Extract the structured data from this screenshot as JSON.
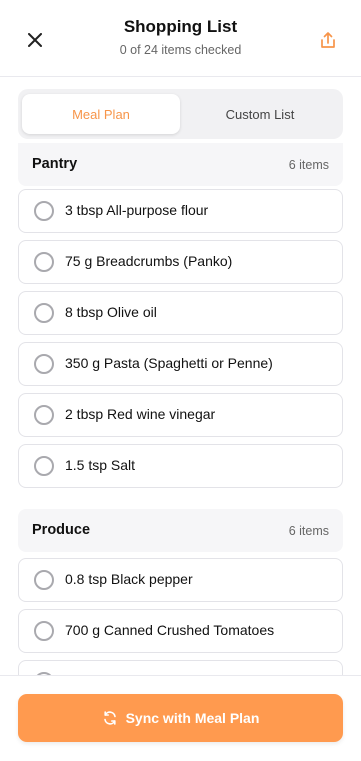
{
  "header": {
    "title": "Shopping List",
    "subtitle": "0 of 24 items checked"
  },
  "tabs": [
    {
      "label": "Meal Plan",
      "active": true
    },
    {
      "label": "Custom List",
      "active": false
    }
  ],
  "sections": {
    "pantry": {
      "title": "Pantry",
      "count": "6 items",
      "items": [
        {
          "label": "3 tbsp All-purpose flour",
          "checked": false
        },
        {
          "label": "75 g Breadcrumbs (Panko)",
          "checked": false
        },
        {
          "label": "8 tbsp Olive oil",
          "checked": false
        },
        {
          "label": "350 g Pasta (Spaghetti or Penne)",
          "checked": false
        },
        {
          "label": "2 tbsp Red wine vinegar",
          "checked": false
        },
        {
          "label": "1.5 tsp Salt",
          "checked": false
        }
      ]
    },
    "produce": {
      "title": "Produce",
      "count": "6 items",
      "items": [
        {
          "label": "0.8 tsp Black pepper",
          "checked": false
        },
        {
          "label": "700 g Canned Crushed Tomatoes",
          "checked": false
        }
      ]
    }
  },
  "footer": {
    "sync_label": "Sync with Meal Plan"
  },
  "colors": {
    "accent": "#ff9a4f",
    "accent_text": "#f7954a",
    "border": "#e3e3e8",
    "section_bg": "#f6f6f8"
  },
  "icons": {
    "close": "close-icon",
    "share": "share-icon",
    "sync": "sync-icon",
    "radio": "radio-unchecked-icon"
  }
}
